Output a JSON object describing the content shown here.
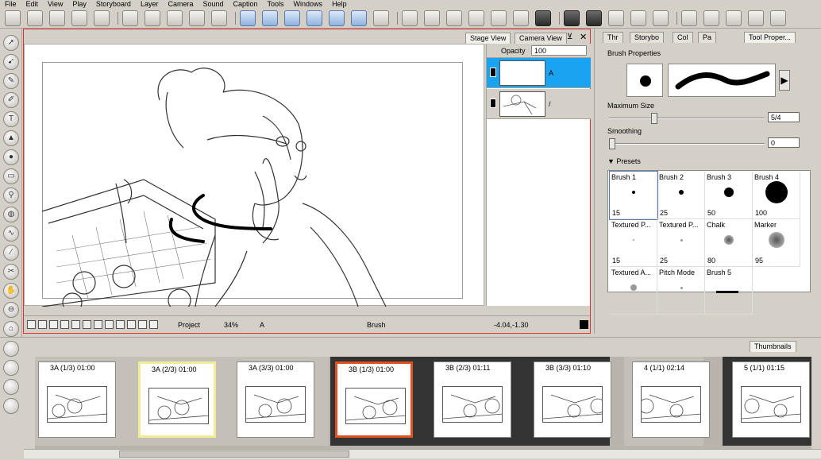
{
  "menu": [
    "File",
    "Edit",
    "View",
    "Play",
    "Storyboard",
    "Layer",
    "Camera",
    "Sound",
    "Caption",
    "Tools",
    "Windows",
    "Help"
  ],
  "stage": {
    "tabs": [
      "Stage View",
      "Camera View"
    ],
    "opacity_label": "Opacity",
    "opacity_value": "100",
    "layers": [
      {
        "name": "A",
        "selected": true
      },
      {
        "name": "/",
        "selected": false
      }
    ],
    "status": {
      "project": "Project",
      "zoom": "34%",
      "panel_label": "A",
      "tool": "Brush",
      "coords": "-4.04,-1.30"
    }
  },
  "tool_panel": {
    "tabs": [
      "Thr",
      "Storybo",
      "Col",
      "Pa",
      "Tool Proper..."
    ],
    "section": "Brush Properties",
    "max_size_label": "Maximum Size",
    "max_size_value": "5/4",
    "max_size_fraction": 0.28,
    "smoothing_label": "Smoothing",
    "smoothing_value": "0",
    "smoothing_fraction": 0.0,
    "presets_label": "Presets",
    "presets": [
      {
        "name": "Brush 1",
        "size": "15",
        "dot": 4
      },
      {
        "name": "Brush 2",
        "size": "25",
        "dot": 6
      },
      {
        "name": "Brush 3",
        "size": "50",
        "dot": 12
      },
      {
        "name": "Brush 4",
        "size": "100",
        "dot": 28
      },
      {
        "name": "Textured P...",
        "size": "15",
        "dot": 2
      },
      {
        "name": "Textured P...",
        "size": "25",
        "dot": 3
      },
      {
        "name": "Chalk",
        "size": "80",
        "dot": 12
      },
      {
        "name": "Marker",
        "size": "95",
        "dot": 20
      },
      {
        "name": "Textured A...",
        "size": "",
        "dot": 8
      },
      {
        "name": "Pitch Mode",
        "size": "",
        "dot": 3
      },
      {
        "name": "Brush 5",
        "size": "",
        "dot": 0
      }
    ]
  },
  "thumbnails": {
    "tab": "Thumbnails",
    "panels": [
      {
        "label": "3A (1/3) 01:00",
        "group": "light",
        "selected": false
      },
      {
        "label": "3A (2/3) 01:00",
        "group": "light",
        "selected": true
      },
      {
        "label": "3A (3/3) 01:00",
        "group": "light",
        "selected": false
      },
      {
        "label": "3B (1/3) 01:00",
        "group": "dark",
        "selected": true
      },
      {
        "label": "3B (2/3) 01:11",
        "group": "dark",
        "selected": false
      },
      {
        "label": "3B (3/3) 01:10",
        "group": "dark",
        "selected": false
      },
      {
        "label": "4 (1/1) 02:14",
        "group": "light",
        "selected": false
      },
      {
        "label": "5 (1/1) 01:15",
        "group": "dark",
        "selected": false
      }
    ]
  },
  "colors": {
    "accent_selected_layer": "#1aa3f0",
    "active_panel_border": "#e05020",
    "selected_thumb_border": "#f2ec98",
    "dark_group": "#333333"
  }
}
